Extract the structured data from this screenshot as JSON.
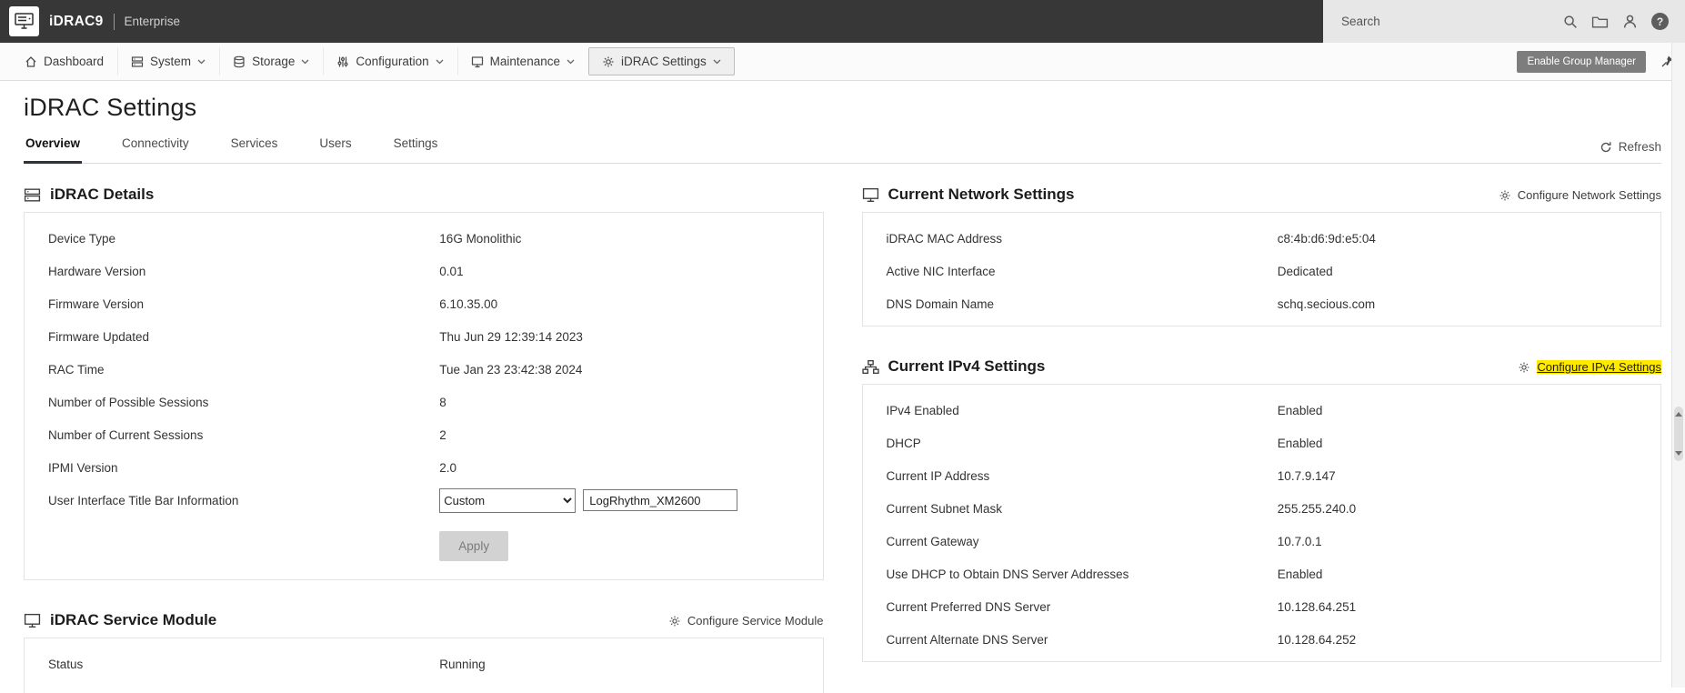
{
  "colors": {
    "topbar_background": "#373737",
    "active_tab_underline": "#2e333b",
    "find_highlight": "#feea00",
    "group_manager_button": "#7d7d7d"
  },
  "topbar": {
    "product": "iDRAC9",
    "edition": "Enterprise",
    "search_placeholder": "Search",
    "help_glyph": "?"
  },
  "nav": {
    "items": [
      {
        "label": "Dashboard"
      },
      {
        "label": "System"
      },
      {
        "label": "Storage"
      },
      {
        "label": "Configuration"
      },
      {
        "label": "Maintenance"
      },
      {
        "label": "iDRAC Settings"
      }
    ],
    "group_manager_button": "Enable Group Manager"
  },
  "page": {
    "title": "iDRAC Settings",
    "tabs": [
      "Overview",
      "Connectivity",
      "Services",
      "Users",
      "Settings"
    ],
    "active_tab": "Overview",
    "refresh_label": "Refresh"
  },
  "idrac_details": {
    "title": "iDRAC Details",
    "rows": [
      {
        "label": "Device Type",
        "value": "16G Monolithic"
      },
      {
        "label": "Hardware Version",
        "value": "0.01"
      },
      {
        "label": "Firmware Version",
        "value": "6.10.35.00"
      },
      {
        "label": "Firmware Updated",
        "value": "Thu Jun 29 12:39:14 2023"
      },
      {
        "label": "RAC Time",
        "value": "Tue Jan 23 23:42:38 2024"
      },
      {
        "label": "Number of Possible Sessions",
        "value": "8"
      },
      {
        "label": "Number of Current Sessions",
        "value": "2"
      },
      {
        "label": "IPMI Version",
        "value": "2.0"
      }
    ],
    "title_bar": {
      "label": "User Interface Title Bar Information",
      "select_value": "Custom",
      "input_value": "LogRhythm_XM2600"
    },
    "apply_button": "Apply"
  },
  "service_module": {
    "title": "iDRAC Service Module",
    "configure_link": "Configure Service Module",
    "rows": [
      {
        "label": "Status",
        "value": "Running"
      }
    ]
  },
  "network_settings": {
    "title": "Current Network Settings",
    "configure_link": "Configure Network Settings",
    "rows": [
      {
        "label": "iDRAC MAC Address",
        "value": "c8:4b:d6:9d:e5:04"
      },
      {
        "label": "Active NIC Interface",
        "value": "Dedicated"
      },
      {
        "label": "DNS Domain Name",
        "value": "schq.secious.com"
      }
    ]
  },
  "ipv4_settings": {
    "title": "Current IPv4 Settings",
    "configure_link": "Configure IPv4 Settings",
    "rows": [
      {
        "label": "IPv4 Enabled",
        "value": "Enabled"
      },
      {
        "label": "DHCP",
        "value": "Enabled"
      },
      {
        "label": "Current IP Address",
        "value": "10.7.9.147"
      },
      {
        "label": "Current Subnet Mask",
        "value": "255.255.240.0"
      },
      {
        "label": "Current Gateway",
        "value": "10.7.0.1"
      },
      {
        "label": "Use DHCP to Obtain DNS Server Addresses",
        "value": "Enabled"
      },
      {
        "label": "Current Preferred DNS Server",
        "value": "10.128.64.251"
      },
      {
        "label": "Current Alternate DNS Server",
        "value": "10.128.64.252"
      }
    ]
  }
}
